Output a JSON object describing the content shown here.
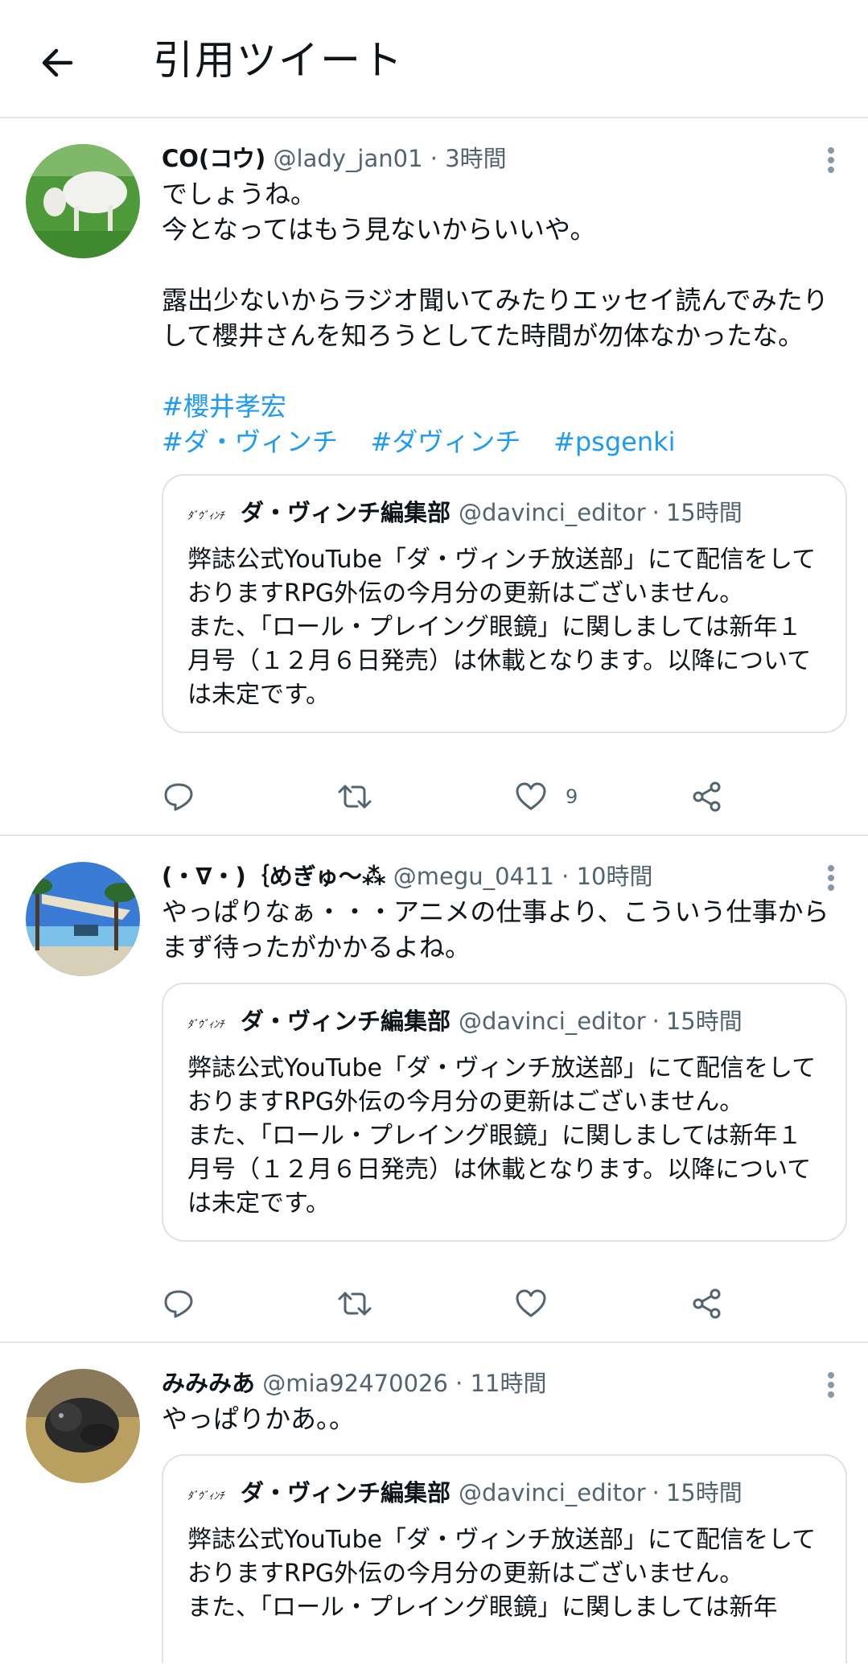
{
  "header": {
    "title": "引用ツイート"
  },
  "tweets": [
    {
      "name": "CO(コウ)",
      "handle": "@lady_jan01",
      "time": "3時間",
      "text": "でしょうね。\n今となってはもう見ないからいいや。\n\n露出少ないからラジオ聞いてみたりエッセイ読んでみたりして櫻井さんを知ろうとしてた時間が勿体なかったな。",
      "hashtags_line1": [
        "#櫻井孝宏"
      ],
      "hashtags_line2": [
        "#ダ・ヴィンチ",
        "#ダヴィンチ",
        "#psgenki"
      ],
      "quote": {
        "logo": "ﾀﾞｳﾞｨﾝﾁ",
        "name": "ダ・ヴィンチ編集部",
        "handle": "@davinci_editor",
        "time": "15時間",
        "text": "弊誌公式YouTube「ダ・ヴィンチ放送部」にて配信をしておりますRPG外伝の今月分の更新はございません。\nまた、「ロール・プレイング眼鏡」に関しましては新年１月号（１２月６日発売）は休載となります。以降については未定です。"
      },
      "like_count": "9"
    },
    {
      "name": "(・∇・)｛めぎゅ〜⁂",
      "handle": "@megu_0411",
      "time": "10時間",
      "text": "やっぱりなぁ・・・アニメの仕事より、こういう仕事からまず待ったがかかるよね。",
      "quote": {
        "logo": "ﾀﾞｳﾞｨﾝﾁ",
        "name": "ダ・ヴィンチ編集部",
        "handle": "@davinci_editor",
        "time": "15時間",
        "text": "弊誌公式YouTube「ダ・ヴィンチ放送部」にて配信をしておりますRPG外伝の今月分の更新はございません。\nまた、「ロール・プレイング眼鏡」に関しましては新年１月号（１２月６日発売）は休載となります。以降については未定です。"
      },
      "like_count": ""
    },
    {
      "name": "みみみあ",
      "handle": "@mia92470026",
      "time": "11時間",
      "text": "やっぱりかあ。。",
      "quote": {
        "logo": "ﾀﾞｳﾞｨﾝﾁ",
        "name": "ダ・ヴィンチ編集部",
        "handle": "@davinci_editor",
        "time": "15時間",
        "text": "弊誌公式YouTube「ダ・ヴィンチ放送部」にて配信をしておりますRPG外伝の今月分の更新はございません。\nまた、「ロール・プレイング眼鏡」に関しましては新年"
      }
    }
  ],
  "separator": "·",
  "colors": {
    "link": "#1d9bf0",
    "secondary": "#536471",
    "border": "#e6e6e6"
  }
}
